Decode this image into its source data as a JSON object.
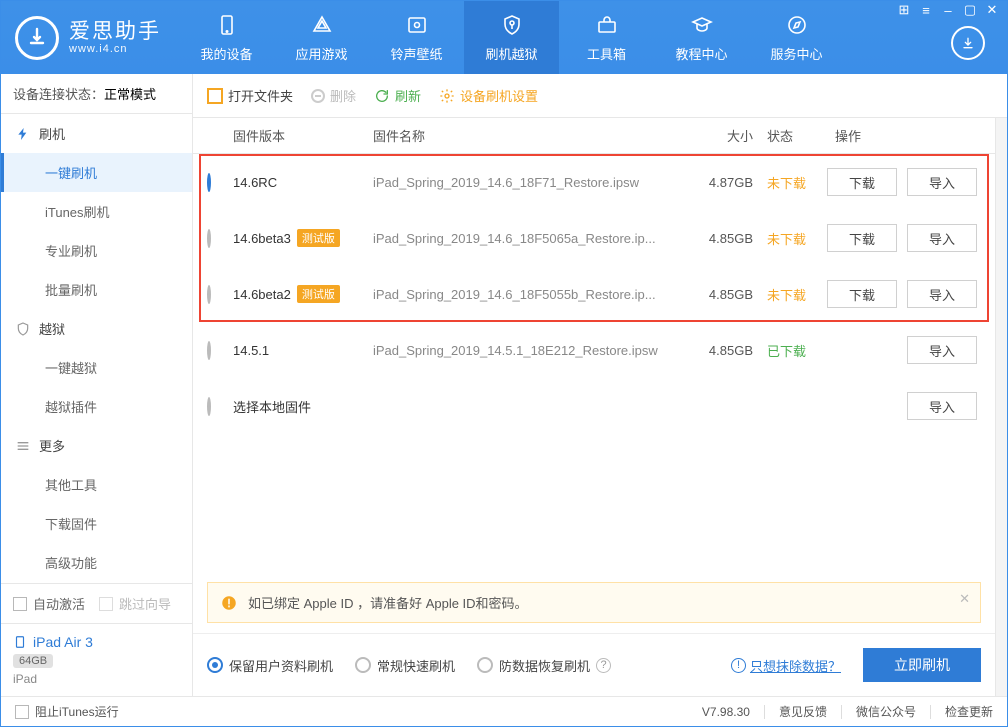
{
  "header": {
    "app_title": "爱思助手",
    "app_sub": "www.i4.cn",
    "nav": [
      {
        "label": "我的设备"
      },
      {
        "label": "应用游戏"
      },
      {
        "label": "铃声壁纸"
      },
      {
        "label": "刷机越狱"
      },
      {
        "label": "工具箱"
      },
      {
        "label": "教程中心"
      },
      {
        "label": "服务中心"
      }
    ]
  },
  "sidebar": {
    "status_label": "设备连接状态：",
    "status_value": "正常模式",
    "group_flash": "刷机",
    "sub_flash": [
      "一键刷机",
      "iTunes刷机",
      "专业刷机",
      "批量刷机"
    ],
    "group_jb": "越狱",
    "sub_jb": [
      "一键越狱",
      "越狱插件"
    ],
    "group_more": "更多",
    "sub_more": [
      "其他工具",
      "下载固件",
      "高级功能"
    ],
    "auto_activate": "自动激活",
    "skip_wizard": "跳过向导",
    "device_name": "iPad Air 3",
    "device_storage": "64GB",
    "device_model": "iPad"
  },
  "toolbar": {
    "open_folder": "打开文件夹",
    "delete": "删除",
    "refresh": "刷新",
    "settings": "设备刷机设置"
  },
  "table": {
    "head": {
      "ver": "固件版本",
      "name": "固件名称",
      "size": "大小",
      "stat": "状态",
      "ops": "操作"
    },
    "ops_dl": "下载",
    "ops_imp": "导入",
    "beta_tag": "测试版",
    "rows": [
      {
        "ver": "14.6RC",
        "beta": false,
        "name": "iPad_Spring_2019_14.6_18F71_Restore.ipsw",
        "size": "4.87GB",
        "stat": "未下载",
        "stat_cls": "stat-undl",
        "dl": true
      },
      {
        "ver": "14.6beta3",
        "beta": true,
        "name": "iPad_Spring_2019_14.6_18F5065a_Restore.ip...",
        "size": "4.85GB",
        "stat": "未下载",
        "stat_cls": "stat-undl",
        "dl": true
      },
      {
        "ver": "14.6beta2",
        "beta": true,
        "name": "iPad_Spring_2019_14.6_18F5055b_Restore.ip...",
        "size": "4.85GB",
        "stat": "未下载",
        "stat_cls": "stat-undl",
        "dl": true
      },
      {
        "ver": "14.5.1",
        "beta": false,
        "name": "iPad_Spring_2019_14.5.1_18E212_Restore.ipsw",
        "size": "4.85GB",
        "stat": "已下载",
        "stat_cls": "stat-dl",
        "dl": false
      }
    ],
    "local_row": "选择本地固件"
  },
  "tip": "如已绑定 Apple ID ，请准备好 Apple ID和密码。",
  "opts": {
    "o1": "保留用户资料刷机",
    "o2": "常规快速刷机",
    "o3": "防数据恢复刷机",
    "link": "只想抹除数据？",
    "primary": "立即刷机"
  },
  "footer": {
    "block_itunes": "阻止iTunes运行",
    "version": "V7.98.30",
    "feedback": "意见反馈",
    "wechat": "微信公众号",
    "update": "检查更新"
  }
}
